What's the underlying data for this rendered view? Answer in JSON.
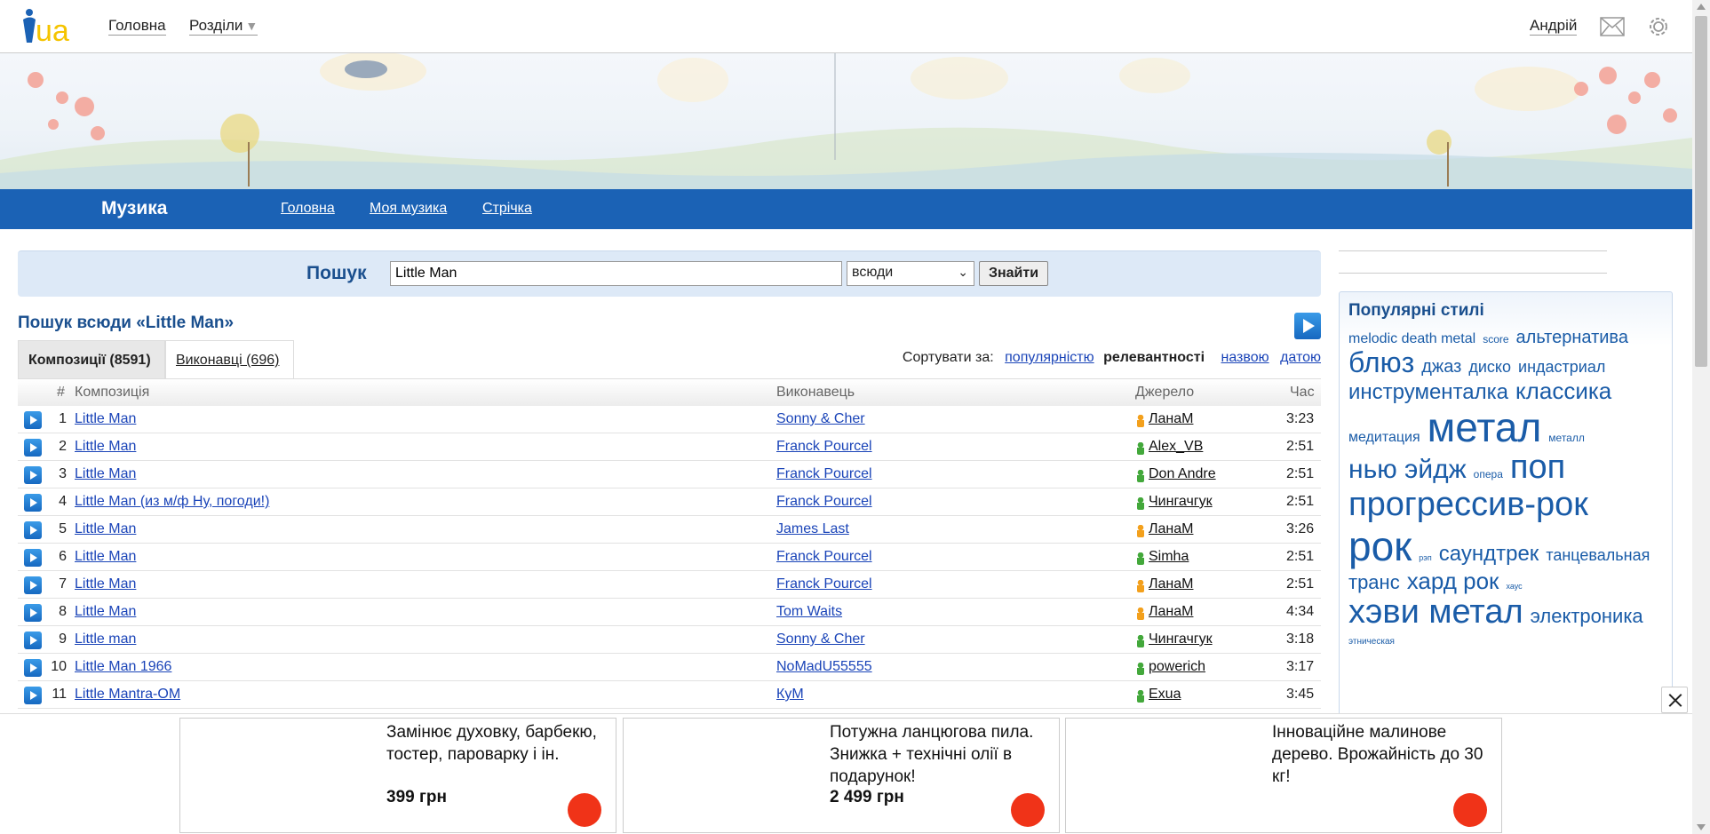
{
  "brand": {
    "logo_text": "ua",
    "accent_color": "#f5c400",
    "brand_blue": "#1b62b5"
  },
  "topbar": {
    "home_label": "Головна",
    "sections_label": "Розділи",
    "user_name": "Андрій"
  },
  "musicbar": {
    "title": "Музика",
    "nav": [
      "Головна",
      "Моя музика",
      "Стрічка"
    ]
  },
  "search": {
    "label": "Пошук",
    "query": "Little Man",
    "scope_selected": "всюди",
    "submit_label": "Знайти"
  },
  "results": {
    "title": "Пошук всюди «Little Man»",
    "tabs": [
      {
        "label": "Композиції (8591)",
        "active": true
      },
      {
        "label": "Виконавці (696)",
        "active": false
      }
    ],
    "sort": {
      "label": "Сортувати за:",
      "options": [
        "популярністю",
        "релевантності",
        "назвою",
        "датою"
      ],
      "current": "релевантності"
    },
    "columns": {
      "num": "#",
      "song": "Композиція",
      "artist": "Виконавець",
      "source": "Джерело",
      "time": "Час"
    },
    "rows": [
      {
        "num": "1",
        "song": "Little Man",
        "artist": "Sonny & Cher",
        "source": "ЛанаМ",
        "source_icon": "user-icon",
        "time": "3:23"
      },
      {
        "num": "2",
        "song": "Little Man",
        "artist": "Franck Pourcel",
        "source": "Alex_VB",
        "source_icon": "share-icon",
        "time": "2:51"
      },
      {
        "num": "3",
        "song": "Little Man",
        "artist": "Franck Pourcel",
        "source": "Don Andre",
        "source_icon": "share-icon",
        "time": "2:51"
      },
      {
        "num": "4",
        "song": "Little Man (из м/ф Ну, погоди!)",
        "artist": "Franck Pourcel",
        "source": "Чингачгук",
        "source_icon": "share-icon",
        "time": "2:51"
      },
      {
        "num": "5",
        "song": "Little Man",
        "artist": "James Last",
        "source": "ЛанаМ",
        "source_icon": "user-icon",
        "time": "3:26"
      },
      {
        "num": "6",
        "song": "Little Man",
        "artist": "Franck Pourcel",
        "source": "Simha",
        "source_icon": "share-icon",
        "time": "2:51"
      },
      {
        "num": "7",
        "song": "Little Man",
        "artist": "Franck Pourcel",
        "source": "ЛанаМ",
        "source_icon": "user-icon",
        "time": "2:51"
      },
      {
        "num": "8",
        "song": "Little Man",
        "artist": "Tom Waits",
        "source": "ЛанаМ",
        "source_icon": "user-icon",
        "time": "4:34"
      },
      {
        "num": "9",
        "song": "Little man",
        "artist": "Sonny & Cher",
        "source": "Чингачгук",
        "source_icon": "share-icon",
        "time": "3:18"
      },
      {
        "num": "10",
        "song": "Little Man 1966",
        "artist": "NoMadU55555",
        "source": "powerich",
        "source_icon": "share-icon",
        "time": "3:17"
      },
      {
        "num": "11",
        "song": "Little Mantra-OM",
        "artist": "КуМ",
        "source": "Exua",
        "source_icon": "share-icon",
        "time": "3:45"
      }
    ]
  },
  "sidebar": {
    "title": "Популярні стилі",
    "tags": [
      {
        "text": "melodic death metal",
        "size": 16
      },
      {
        "text": "score",
        "size": 12
      },
      {
        "text": "альтернатива",
        "size": 20
      },
      {
        "text": "блюз",
        "size": 32
      },
      {
        "text": "джаз",
        "size": 20
      },
      {
        "text": "диско",
        "size": 18
      },
      {
        "text": "индастриал",
        "size": 18
      },
      {
        "text": "инструменталка",
        "size": 24
      },
      {
        "text": "классика",
        "size": 26
      },
      {
        "text": "медитация",
        "size": 16
      },
      {
        "text": "метал",
        "size": 46
      },
      {
        "text": "металл",
        "size": 12
      },
      {
        "text": "нью эйдж",
        "size": 30
      },
      {
        "text": "опера",
        "size": 12
      },
      {
        "text": "поп",
        "size": 38
      },
      {
        "text": "прогрессив-рок",
        "size": 38
      },
      {
        "text": "рок",
        "size": 46
      },
      {
        "text": "рэп",
        "size": 9
      },
      {
        "text": "саундтрек",
        "size": 24
      },
      {
        "text": "танцевальная",
        "size": 18
      },
      {
        "text": "транс",
        "size": 22
      },
      {
        "text": "хард рок",
        "size": 26
      },
      {
        "text": "хаус",
        "size": 9
      },
      {
        "text": "хэви метал",
        "size": 38
      },
      {
        "text": "электроника",
        "size": 22
      },
      {
        "text": "этническая",
        "size": 10
      }
    ]
  },
  "ads": [
    {
      "text": "Замінює духовку, барбекю, тостер, пароварку і ін.",
      "price": "399 грн"
    },
    {
      "text": "Потужна ланцюгова пила. Знижка + технічні олії в подарунок!",
      "price": "2 499 грн"
    },
    {
      "text": "Інноваційне малинове дерево. Врожайність до 30 кг!",
      "price": ""
    }
  ]
}
